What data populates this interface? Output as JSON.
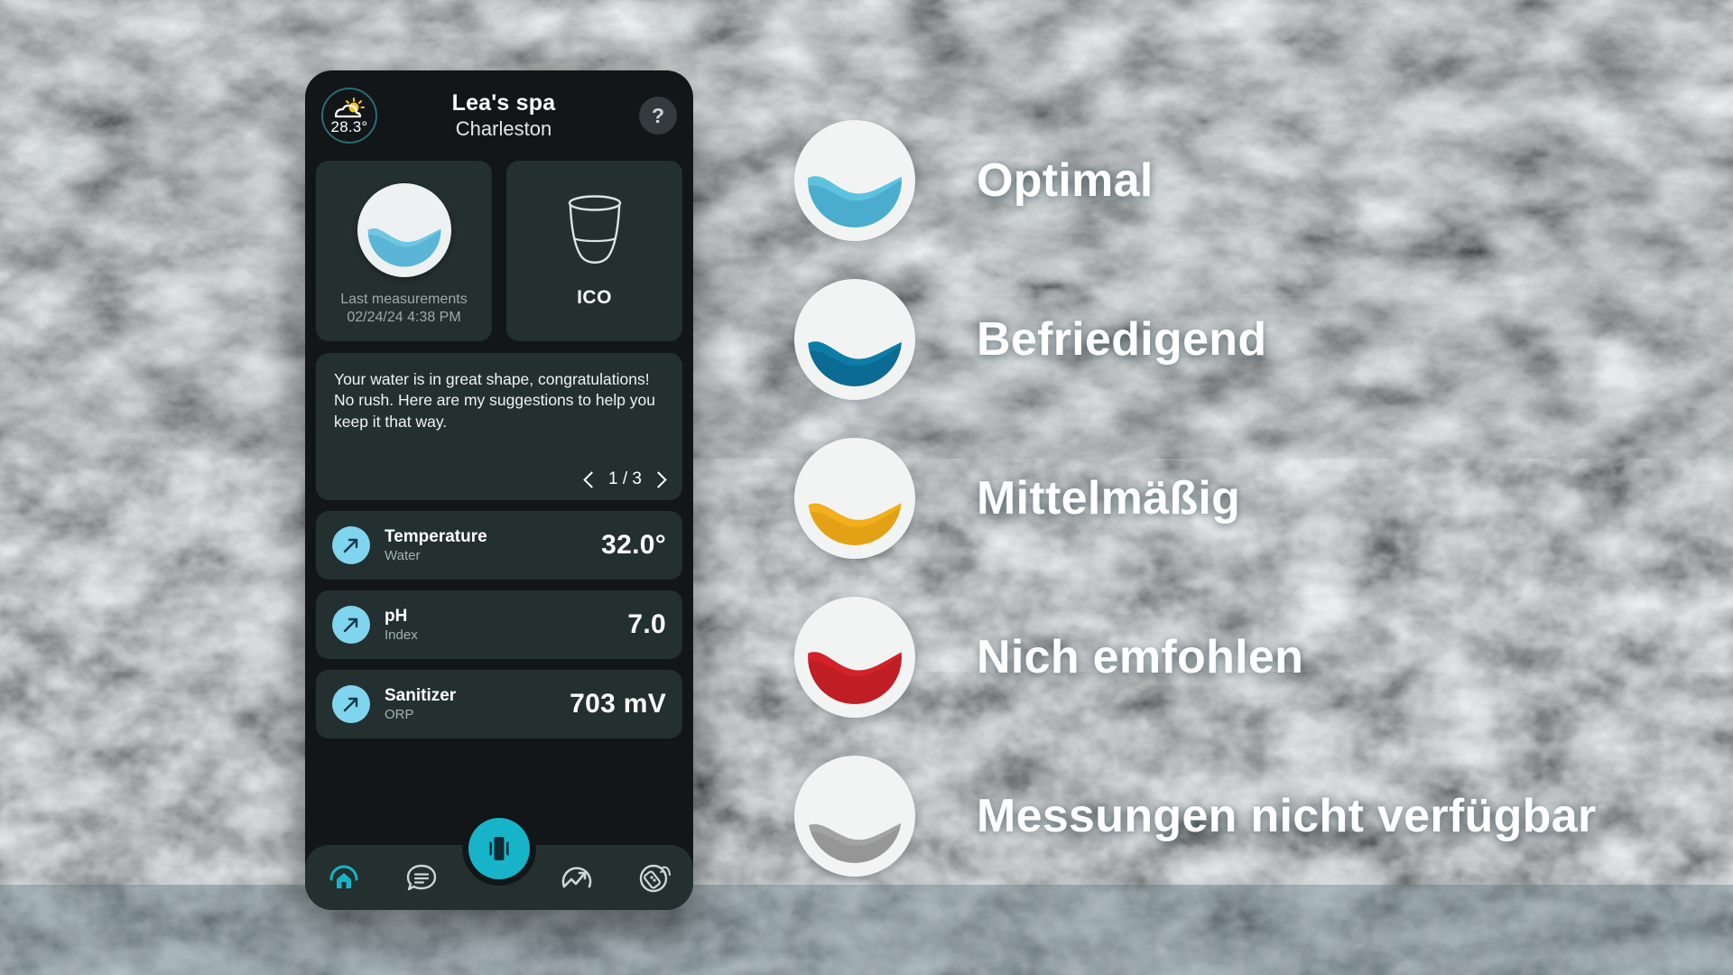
{
  "phone": {
    "header": {
      "weather_temp": "28.3°",
      "weather_icon": "sun-cloud-icon",
      "title": "Lea's spa",
      "subtitle": "Charleston",
      "help_label": "?"
    },
    "cards": {
      "measurements": {
        "icon": "water-quality-optimal-icon",
        "label": "Last measurements",
        "timestamp": "02/24/24 4:38 PM"
      },
      "device": {
        "icon": "ico-device-icon",
        "label": "ICO"
      }
    },
    "message": {
      "text": "Your water is in great shape, congratulations! No rush. Here are my suggestions to help you keep it that way.",
      "pager": "1 / 3",
      "prev_icon": "chevron-left-icon",
      "next_icon": "chevron-right-icon"
    },
    "metrics": [
      {
        "name": "Temperature",
        "unit": "Water",
        "value": "32.0°",
        "icon": "trend-up-arrow-icon"
      },
      {
        "name": "pH",
        "unit": "Index",
        "value": "7.0",
        "icon": "trend-up-arrow-icon"
      },
      {
        "name": "Sanitizer",
        "unit": "ORP",
        "value": "703 mV",
        "icon": "trend-up-arrow-icon"
      }
    ],
    "nav": {
      "items": [
        {
          "icon": "home-icon",
          "active": true
        },
        {
          "icon": "chat-icon",
          "active": false
        },
        {
          "icon": "analytics-icon",
          "active": false
        },
        {
          "icon": "remote-icon",
          "active": false
        }
      ],
      "fab_icon": "spa-device-icon"
    }
  },
  "legend": {
    "items": [
      {
        "label": "Optimal",
        "color": "#5cc2e0"
      },
      {
        "label": "Befriedigend",
        "color": "#0d7da8"
      },
      {
        "label": "Mittelmäßig",
        "color": "#f2b01e"
      },
      {
        "label": "Nich emfohlen",
        "color": "#d2232a"
      },
      {
        "label": "Messungen nicht verfügbar",
        "color": "#a3a3a3"
      }
    ]
  },
  "colors": {
    "accent": "#17b3c9",
    "card_bg": "#242f2f",
    "phone_bg": "#121619",
    "metric_icon_bg": "#7fd4ee"
  }
}
